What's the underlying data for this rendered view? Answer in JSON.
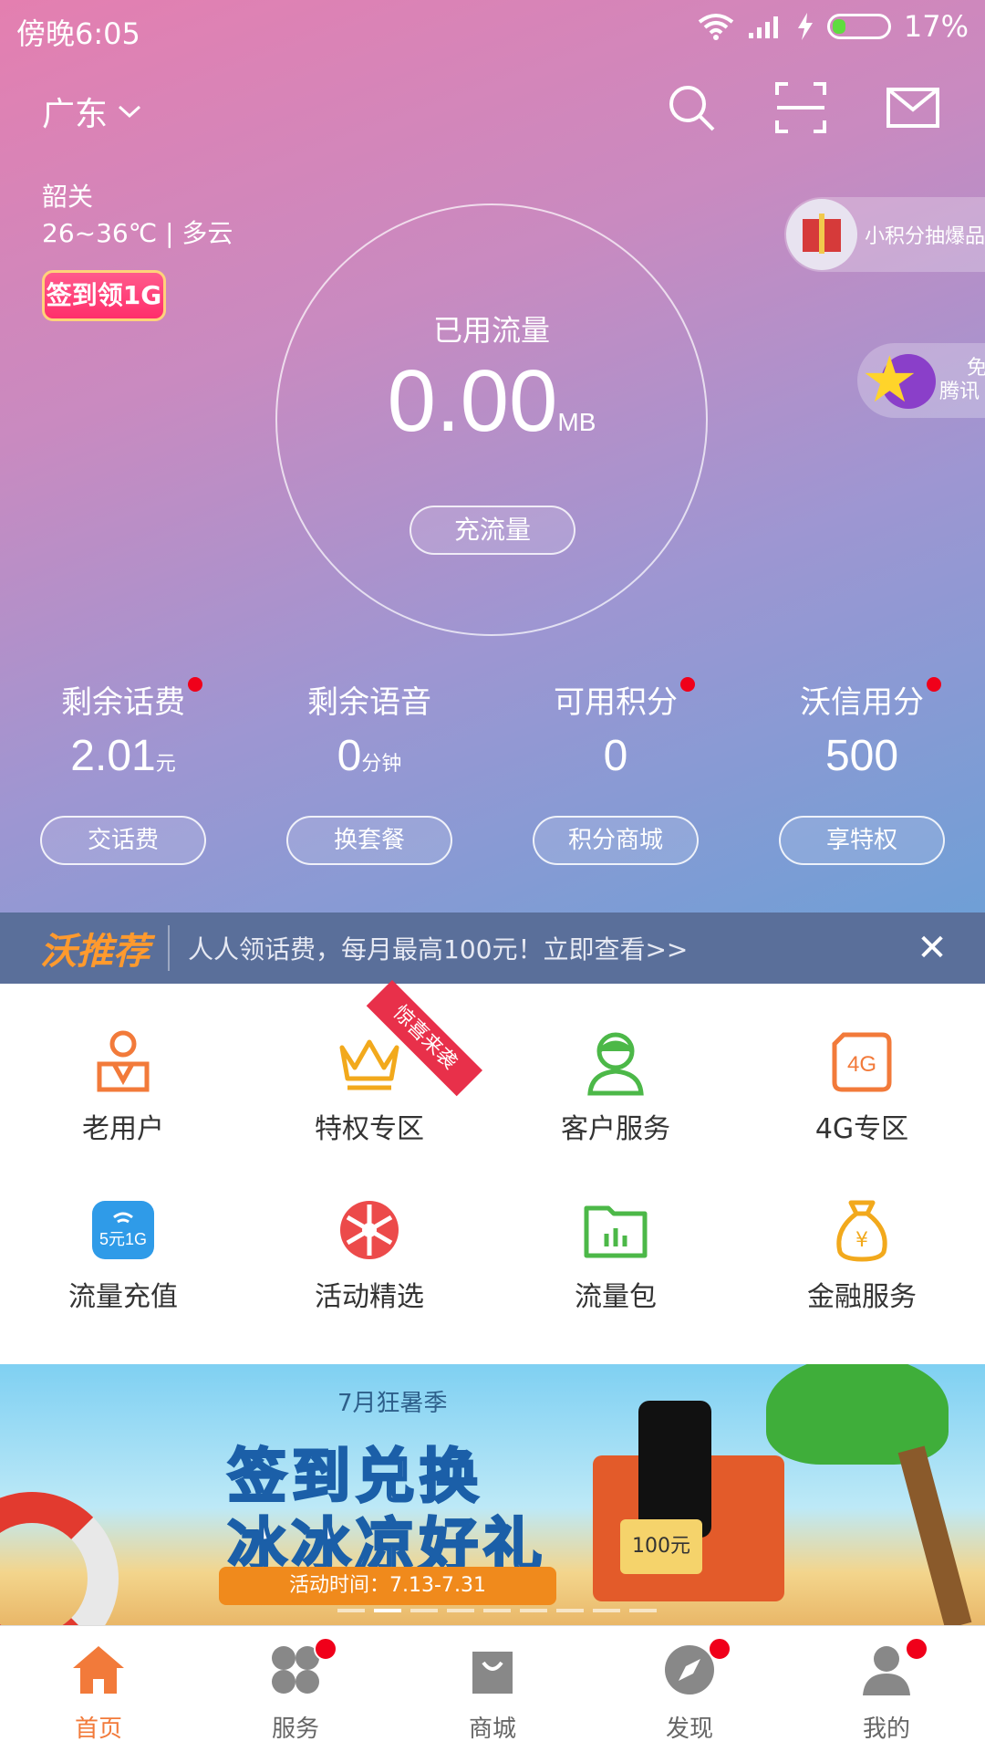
{
  "status": {
    "time": "傍晚6:05",
    "battery": "17%"
  },
  "header": {
    "region": "广东"
  },
  "weather": {
    "city": "韶关",
    "desc": "26~36℃ | 多云"
  },
  "signin_badge": "签到领1G",
  "usage": {
    "label": "已用流量",
    "value": "0.00",
    "unit": "MB",
    "button": "充流量"
  },
  "promos": {
    "points_draw": "小积分抽爆品",
    "tencent_line1": "免",
    "tencent_line2": "腾讯"
  },
  "stats": [
    {
      "label": "剩余话费",
      "value": "2.01",
      "unit": "元",
      "dot": true,
      "action": "交话费"
    },
    {
      "label": "剩余语音",
      "value": "0",
      "unit": "分钟",
      "dot": false,
      "action": "换套餐"
    },
    {
      "label": "可用积分",
      "value": "0",
      "unit": "",
      "dot": true,
      "action": "积分商城"
    },
    {
      "label": "沃信用分",
      "value": "500",
      "unit": "",
      "dot": true,
      "action": "享特权"
    }
  ],
  "recommend": {
    "brand": "沃推荐",
    "text": "人人领话费，每月最高100元！立即查看>>"
  },
  "ribbon": "惊喜来袭",
  "services": [
    {
      "label": "老用户",
      "icon": "old-user-icon",
      "color": "#f27a3a"
    },
    {
      "label": "特权专区",
      "icon": "crown-icon",
      "color": "#f2a91c"
    },
    {
      "label": "客户服务",
      "icon": "customer-service-icon",
      "color": "#4cb848"
    },
    {
      "label": "4G专区",
      "icon": "4g-icon",
      "color": "#f27a3a"
    },
    {
      "label": "流量充值",
      "icon": "data-recharge-icon",
      "color": "#2f9be8",
      "badge": "5元1G"
    },
    {
      "label": "活动精选",
      "icon": "wheel-icon",
      "color": "#ec4a4a"
    },
    {
      "label": "流量包",
      "icon": "folder-chart-icon",
      "color": "#4cb848"
    },
    {
      "label": "金融服务",
      "icon": "money-bag-icon",
      "color": "#f2a91c"
    }
  ],
  "banner": {
    "season": "7月狂暑季",
    "title1": "签到兑换",
    "title2": "冰冰凉好礼",
    "date": "活动时间：7.13-7.31",
    "card": "100元"
  },
  "tabs": [
    {
      "label": "首页",
      "icon": "home-icon",
      "active": true,
      "dot": false
    },
    {
      "label": "服务",
      "icon": "services-icon",
      "active": false,
      "dot": true
    },
    {
      "label": "商城",
      "icon": "shop-bag-icon",
      "active": false,
      "dot": false
    },
    {
      "label": "发现",
      "icon": "compass-icon",
      "active": false,
      "dot": true
    },
    {
      "label": "我的",
      "icon": "profile-icon",
      "active": false,
      "dot": true
    }
  ],
  "colors": {
    "accent": "#f27a3a",
    "recommend_bar": "#5a6f9a",
    "red_dot": "#f0001a"
  }
}
